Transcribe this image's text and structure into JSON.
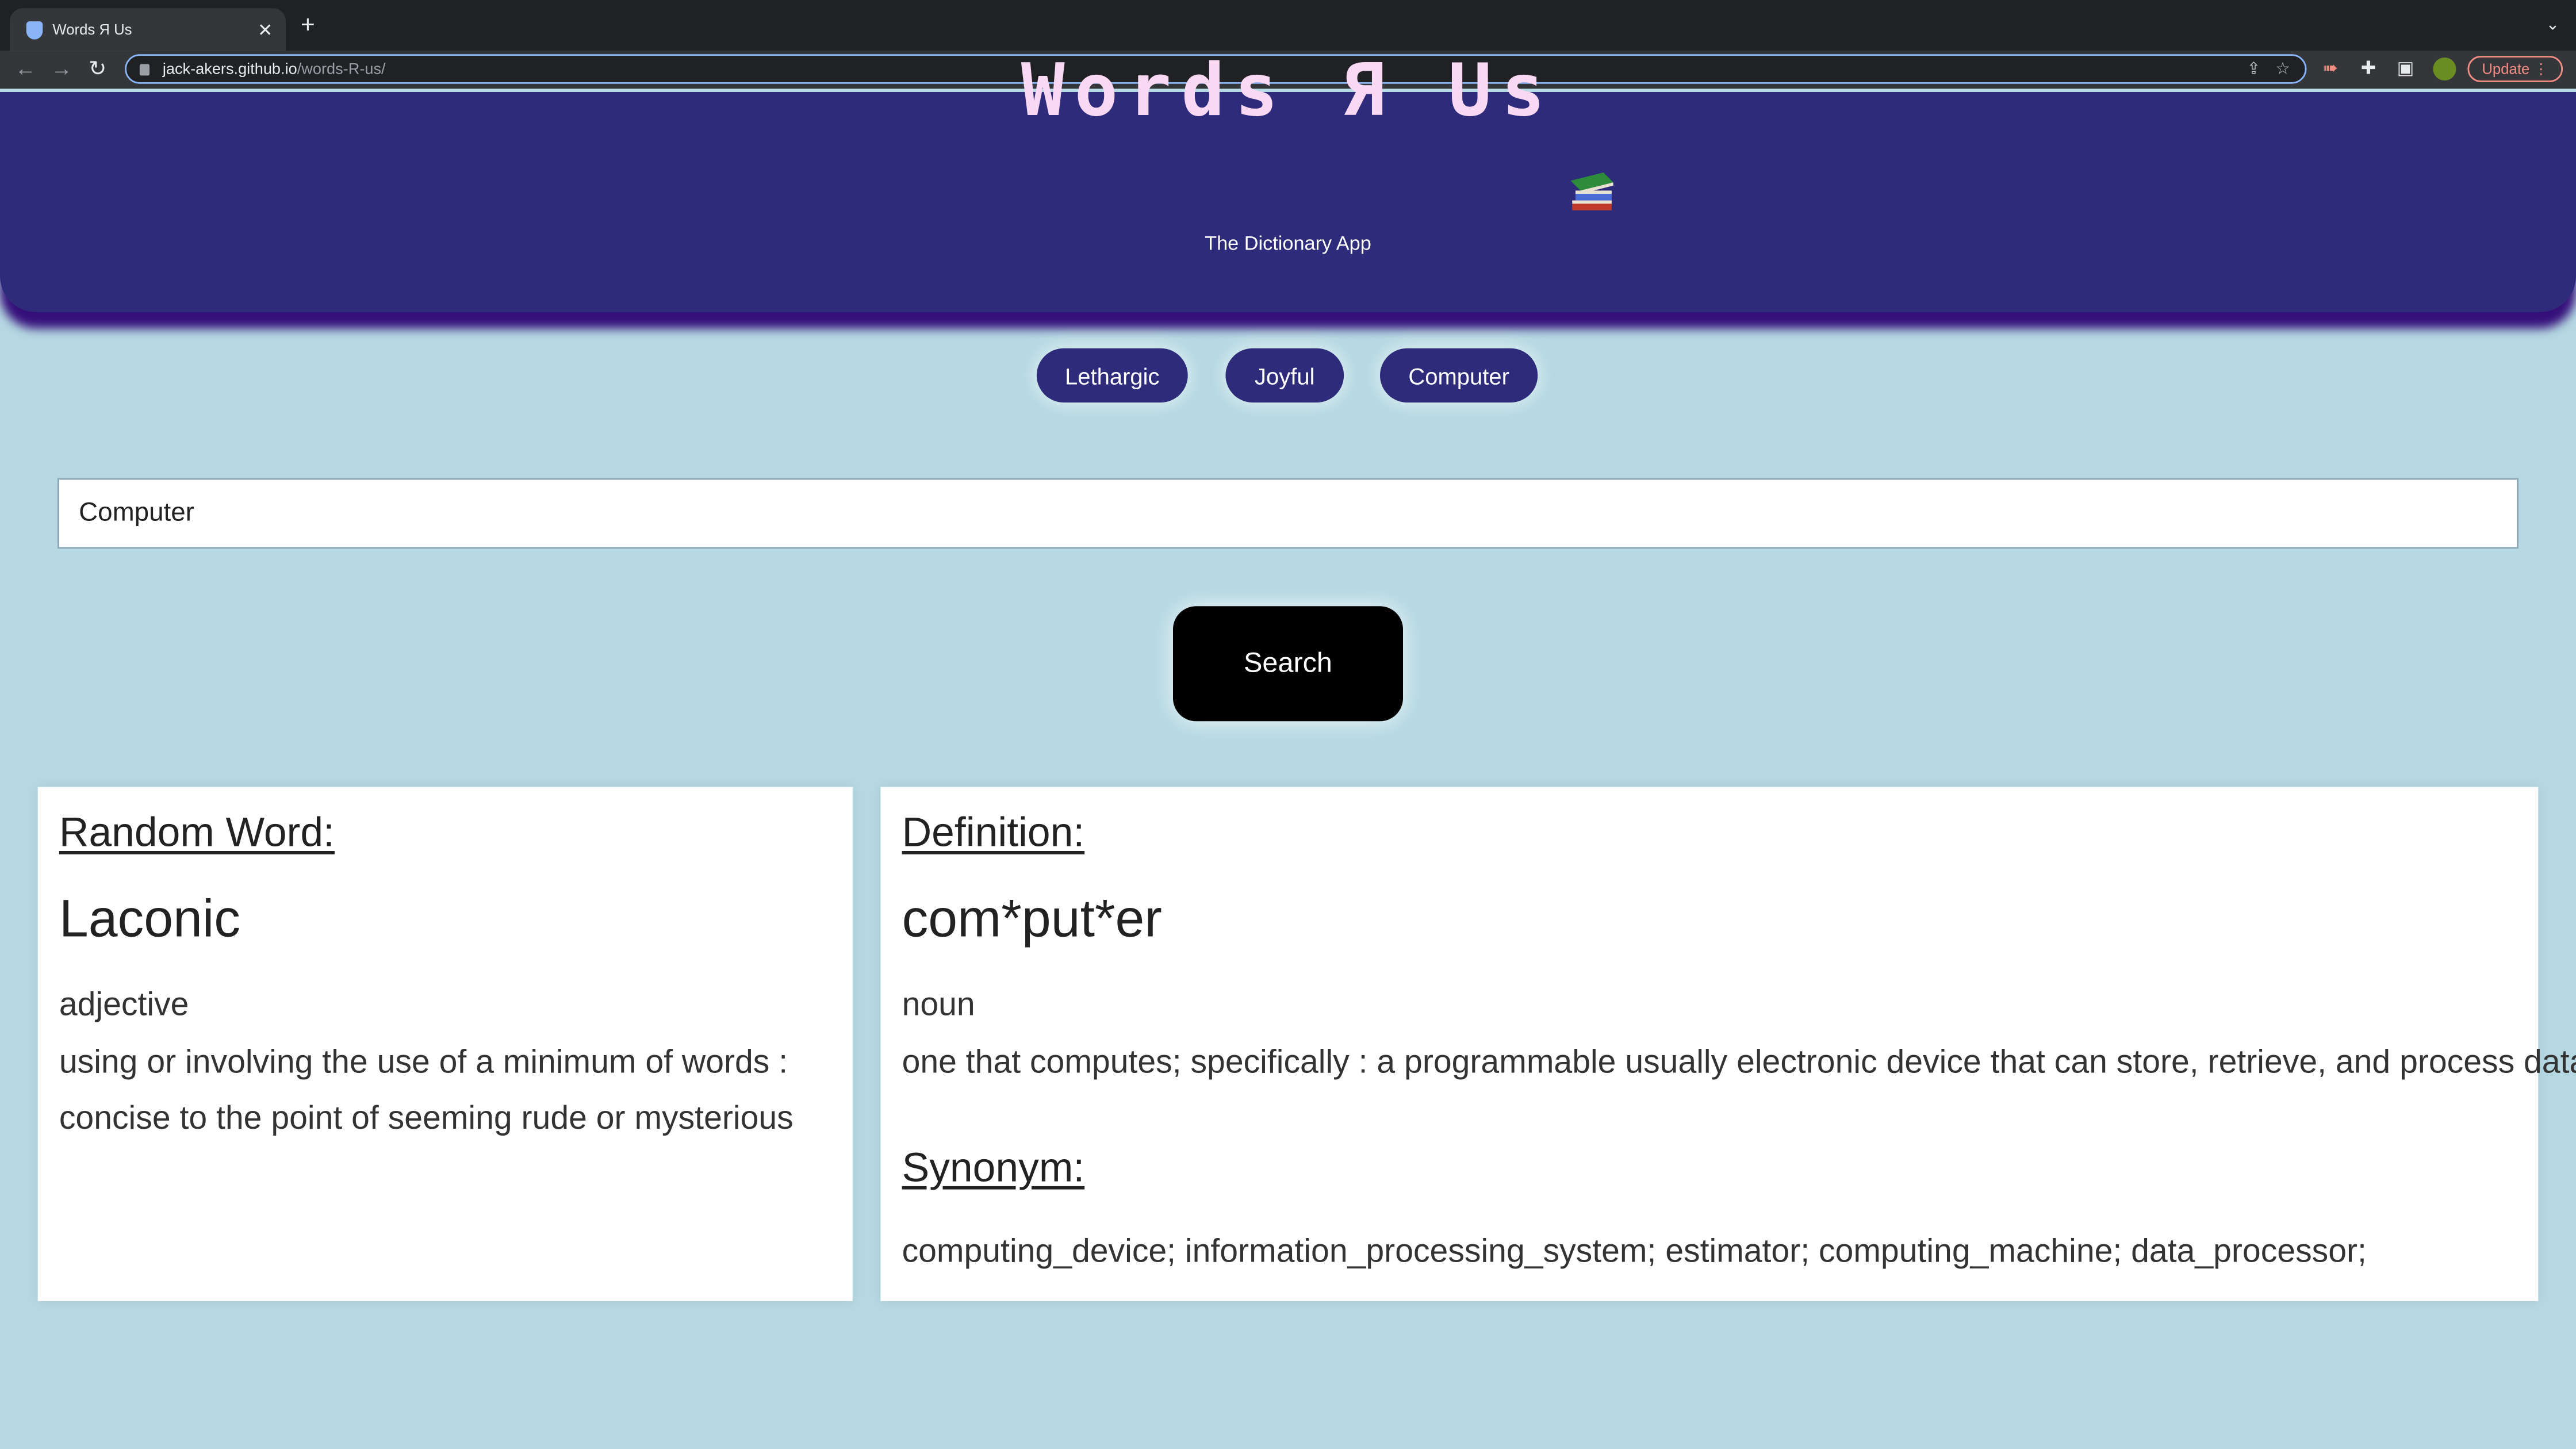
{
  "browser": {
    "tab_title": "Words Я Us",
    "url_host": "jack-akers.github.io",
    "url_path": "/words-R-us/",
    "update_label": "Update"
  },
  "header": {
    "title": "Words Я Us",
    "subtitle": "The Dictionary App",
    "icon": "books-icon"
  },
  "quick_words": [
    "Lethargic",
    "Joyful",
    "Computer"
  ],
  "search": {
    "value": "Computer",
    "button_label": "Search"
  },
  "random_word": {
    "heading": "Random Word:",
    "word": "Laconic",
    "part_of_speech": "adjective",
    "definition_line1": "using or involving the use of a minimum of words :",
    "definition_line2": "concise to the point of seeming rude or mysterious"
  },
  "definition": {
    "heading": "Definition:",
    "word": "com*put*er",
    "part_of_speech": "noun",
    "definition": "one that computes; specifically : a programmable usually electronic device that can store, retrieve, and process data;",
    "synonym_heading": "Synonym:",
    "synonyms": "computing_device; information_processing_system; estimator; computing_machine; data_processor;"
  },
  "colors": {
    "page_bg": "#b5d8e2",
    "header_bg": "#2d2b7a",
    "title_color": "#f8d8f3",
    "button_bg": "#000000"
  }
}
